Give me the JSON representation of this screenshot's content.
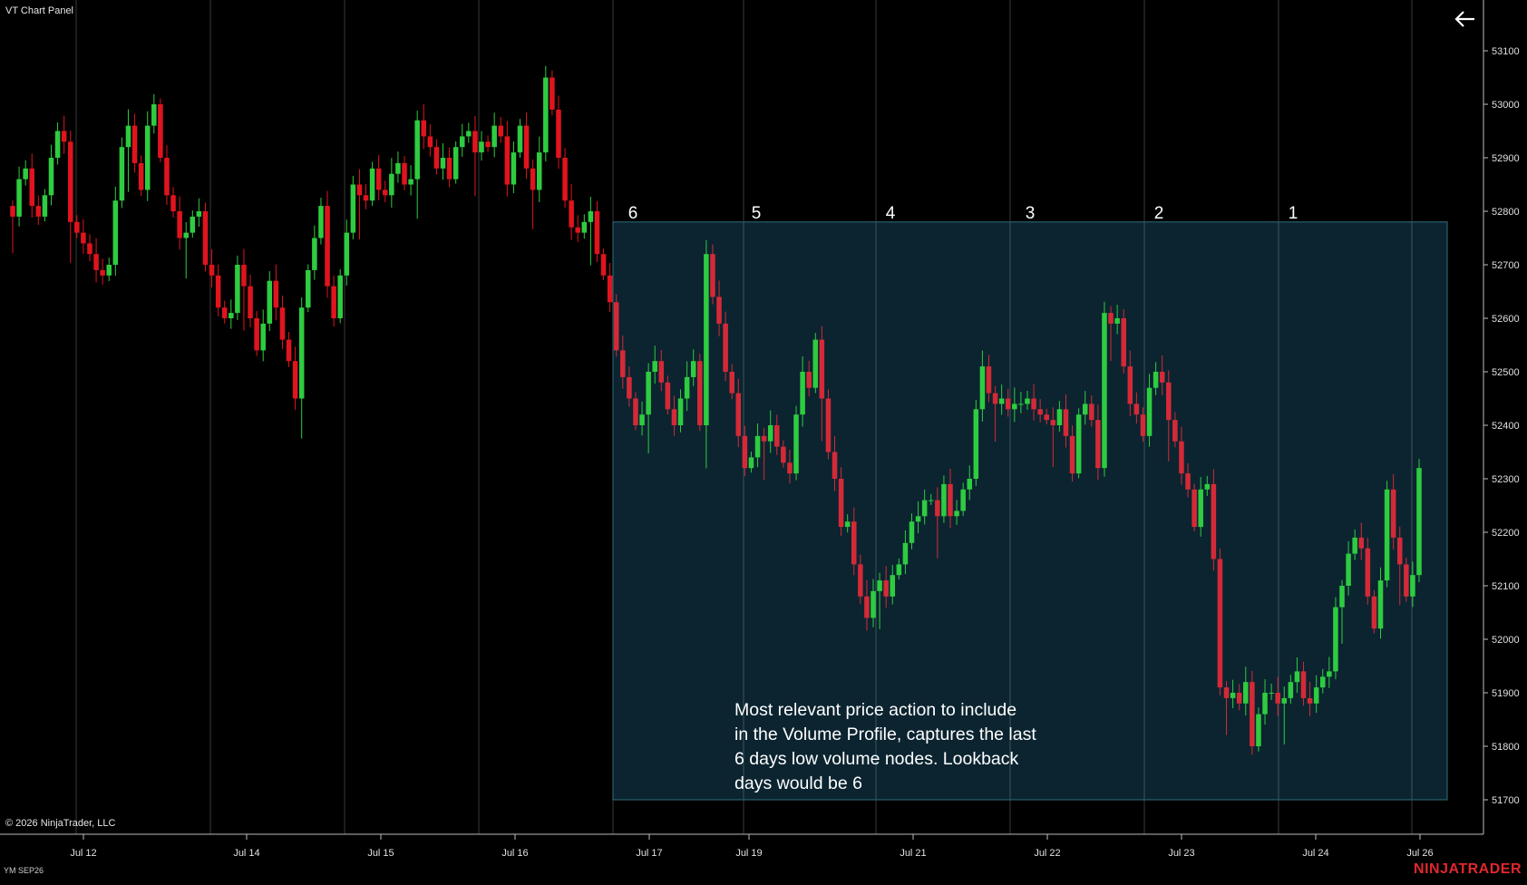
{
  "panel_title": "VT Chart Panel",
  "instrument": "YM SEP26",
  "copyright": "© 2026 NinjaTrader, LLC",
  "brand": "NINJATRADER",
  "toolbar": {
    "back_icon": "arrow-left-icon"
  },
  "annotation": {
    "text": "Most relevant price action to include in the Volume Profile, captures the last 6 days low volume nodes. Lookback days would be 6",
    "lines": [
      "Most relevant price action to include",
      "in the Volume Profile, captures the last",
      "6 days low volume nodes. Lookback",
      "days would be 6"
    ],
    "box_color": "#0b2430",
    "box_border": "#2f6e7e"
  },
  "colors": {
    "up": "#2ecc40",
    "down": "#e0141e",
    "down_in_box": "#d42a38",
    "background": "#000000",
    "grid": "#3a3a3a"
  },
  "chart_data": {
    "type": "candlestick",
    "y_axis": {
      "min": 51700,
      "max": 53100,
      "ticks": [
        53100,
        53000,
        52900,
        52800,
        52700,
        52600,
        52500,
        52400,
        52300,
        52200,
        52100,
        52000,
        51900,
        51800,
        51700
      ]
    },
    "x_axis": {
      "labels": [
        "Jul 12",
        "Jul 14",
        "Jul 15",
        "Jul 16",
        "Jul 17",
        "Jul 19",
        "Jul 21",
        "Jul 22",
        "Jul 23",
        "Jul 24",
        "Jul 26"
      ]
    },
    "session_day_labels": [
      "6",
      "5",
      "4",
      "3",
      "2",
      "1"
    ],
    "lookback_box": {
      "price_top": 52780,
      "price_bottom": 51700
    },
    "series_open": 52810,
    "closes": [
      52790,
      52860,
      52880,
      52810,
      52790,
      52830,
      52900,
      52950,
      52930,
      52780,
      52760,
      52740,
      52720,
      52690,
      52680,
      52700,
      52820,
      52920,
      52960,
      52890,
      52840,
      52960,
      53000,
      52900,
      52830,
      52800,
      52750,
      52760,
      52790,
      52800,
      52700,
      52680,
      52620,
      52600,
      52610,
      52700,
      52660,
      52600,
      52540,
      52590,
      52670,
      52620,
      52560,
      52520,
      52450,
      52620,
      52690,
      52750,
      52810,
      52660,
      52600,
      52680,
      52760,
      52850,
      52830,
      52820,
      52880,
      52840,
      52830,
      52870,
      52890,
      52850,
      52860,
      52970,
      52940,
      52920,
      52880,
      52900,
      52860,
      52920,
      52940,
      52950,
      52910,
      52930,
      52920,
      52960,
      52940,
      52850,
      52910,
      52960,
      52880,
      52840,
      52910,
      53050,
      52990,
      52900,
      52820,
      52770,
      52760,
      52780,
      52800,
      52720,
      52680,
      52630,
      52540,
      52490,
      52450,
      52400,
      52420,
      52500,
      52520,
      52480,
      52430,
      52400,
      52450,
      52490,
      52520,
      52400,
      52720,
      52640,
      52590,
      52500,
      52460,
      52380,
      52320,
      52340,
      52380,
      52370,
      52400,
      52360,
      52330,
      52310,
      52420,
      52500,
      52470,
      52560,
      52450,
      52350,
      52300,
      52210,
      52220,
      52140,
      52080,
      52040,
      52090,
      52110,
      52080,
      52120,
      52140,
      52180,
      52220,
      52230,
      52260,
      52260,
      52230,
      52290,
      52230,
      52240,
      52280,
      52300,
      52430,
      52510,
      52460,
      52440,
      52450,
      52430,
      52440,
      52440,
      52450,
      52430,
      52420,
      52410,
      52400,
      52430,
      52380,
      52310,
      52420,
      52440,
      52410,
      52320,
      52610,
      52590,
      52600,
      52510,
      52440,
      52420,
      52380,
      52470,
      52500,
      52480,
      52410,
      52370,
      52310,
      52280,
      52210,
      52280,
      52290,
      52150,
      51910,
      51890,
      51900,
      51880,
      51920,
      51800,
      51860,
      51900,
      51900,
      51880,
      51890,
      51920,
      51940,
      51890,
      51880,
      51910,
      51930,
      51940,
      52060,
      52100,
      52160,
      52190,
      52170,
      52080,
      52020,
      52110,
      52280,
      52190,
      52140,
      52080,
      52120,
      52320
    ],
    "up_color": "#2ecc40",
    "down_color": "#e0141e"
  }
}
